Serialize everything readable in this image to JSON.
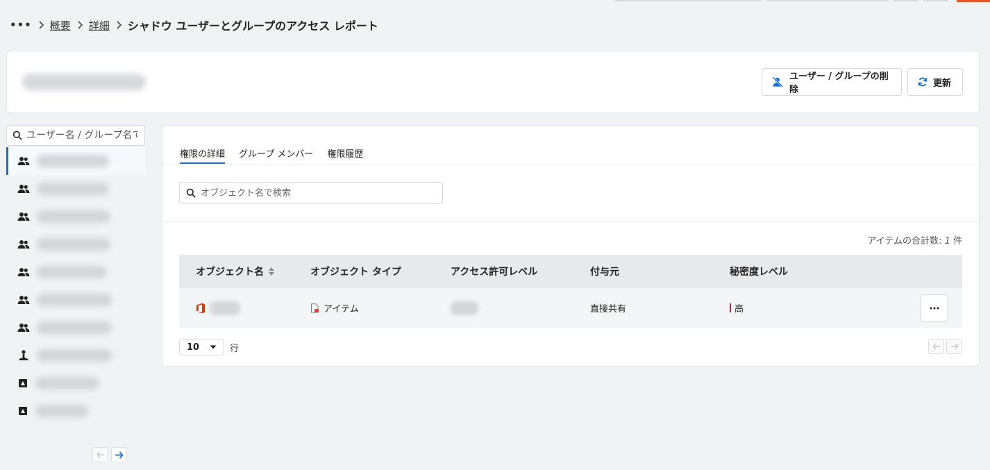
{
  "breadcrumb": {
    "more": "•••",
    "items": [
      "概要",
      "詳細"
    ],
    "current": "シャドウ ユーザーとグループのアクセス レポート"
  },
  "header": {
    "title_blurred": "",
    "delete_button": "ユーザー / グループの削除",
    "refresh_button": "更新"
  },
  "sidebar": {
    "search_placeholder": "ユーザー名 / グループ名で…",
    "items": [
      {
        "icon": "group-icon"
      },
      {
        "icon": "group-icon"
      },
      {
        "icon": "group-icon"
      },
      {
        "icon": "group-icon"
      },
      {
        "icon": "group-icon"
      },
      {
        "icon": "group-icon"
      },
      {
        "icon": "group-icon"
      },
      {
        "icon": "person-icon"
      },
      {
        "icon": "app-icon"
      },
      {
        "icon": "app-icon"
      }
    ]
  },
  "tabs": [
    "権限の詳細",
    "グループ メンバー",
    "権限履歴"
  ],
  "object_search_placeholder": "オブジェクト名で検索",
  "total": {
    "label": "アイテムの合計数:",
    "count": "1",
    "unit": "件"
  },
  "table": {
    "headers": [
      "オブジェクト名",
      "オブジェクト タイプ",
      "アクセス許可レベル",
      "付与元",
      "秘密度レベル"
    ],
    "rows": [
      {
        "name": "",
        "type": "アイテム",
        "access_level": "",
        "granted_via": "直接共有",
        "sensitivity": "高"
      }
    ]
  },
  "pagination": {
    "page_size": "10",
    "rows_label": "行"
  },
  "colors": {
    "accent": "#1a6fc4",
    "office": "#d83b01",
    "sensitivity_high": "#c4213b"
  }
}
